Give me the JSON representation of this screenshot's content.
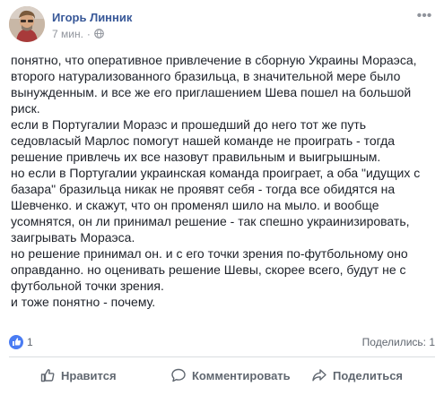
{
  "post": {
    "author": "Игорь Линник",
    "time": "7 мин.",
    "separator": "·",
    "paragraphs": [
      "понятно, что оперативное привлечение в сборную Украины Мораэса, второго натурализованного бразильца, в значительной мере было вынужденным. и все же его приглашением Шева пошел на большой риск.",
      "если в Португалии Мораэс и прошедший до него тот же путь седовласый Марлос помогут нашей команде не проиграть - тогда решение привлечь их все назовут правильным и выигрышным.",
      "но если в Португалии украинская команда проиграет, а оба \"идущих с базара\" бразильца никак не проявят себя - тогда все обидятся на Шевченко. и скажут, что он променял шило на мыло. и вообще усомнятся, он ли принимал решение - так спешно украинизировать, заигрывать Мораэса.",
      "но решение принимал он. и с его точки зрения по-футбольному оно оправданно. но оценивать решение Шевы, скорее всего, будут не с футбольной точки зрения.",
      "и тоже понятно - почему."
    ]
  },
  "reactions": {
    "count": "1",
    "icon": "like-icon",
    "color": "#4a7cf3"
  },
  "shares": {
    "label": "Поделились: 1"
  },
  "actions": {
    "like_label": "Нравится",
    "comment_label": "Комментировать",
    "share_label": "Поделиться"
  },
  "colors": {
    "link": "#385898",
    "meta": "#90949c",
    "action": "#606770",
    "divider": "#dadde1"
  }
}
